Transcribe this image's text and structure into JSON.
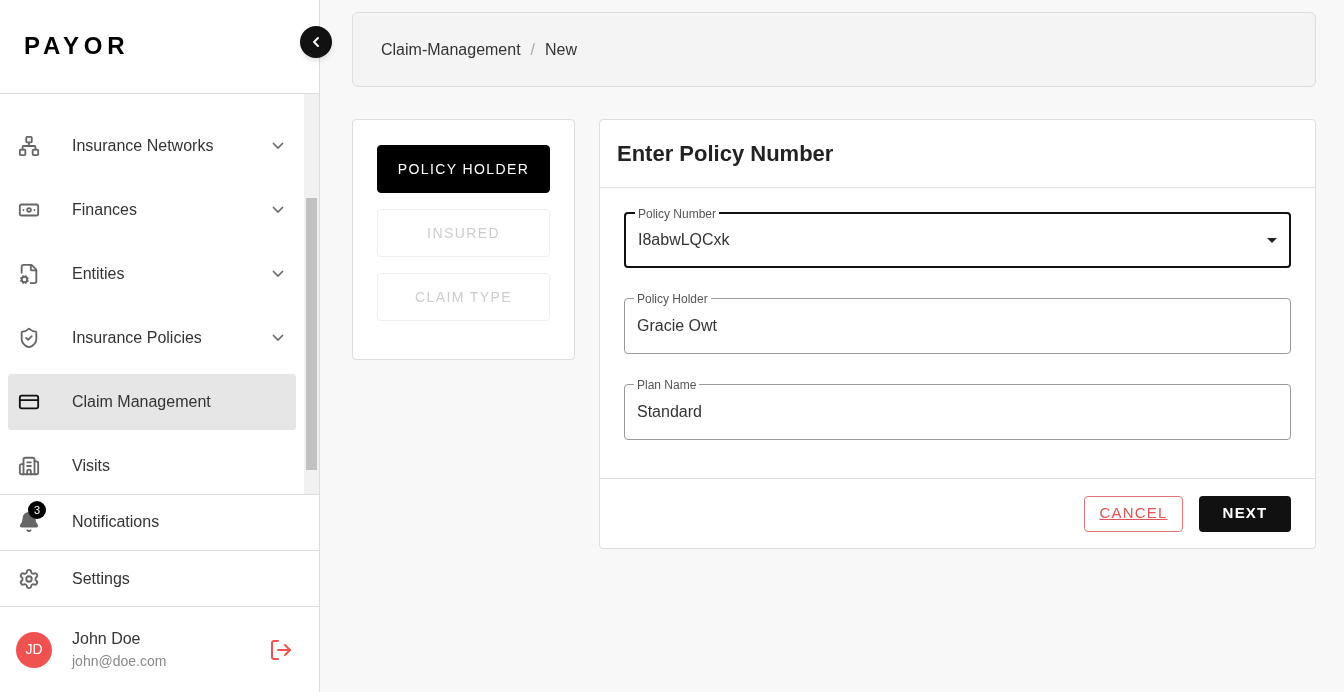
{
  "sidebar": {
    "logo": "PAYOR",
    "items": [
      {
        "label": "Insurance Networks",
        "expandable": true,
        "selected": false
      },
      {
        "label": "Finances",
        "expandable": true,
        "selected": false
      },
      {
        "label": "Entities",
        "expandable": true,
        "selected": false
      },
      {
        "label": "Insurance Policies",
        "expandable": true,
        "selected": false
      },
      {
        "label": "Claim Management",
        "expandable": false,
        "selected": true
      },
      {
        "label": "Visits",
        "expandable": false,
        "selected": false
      }
    ],
    "notifications": {
      "label": "Notifications",
      "badge": "3"
    },
    "settings": {
      "label": "Settings"
    },
    "user": {
      "initials": "JD",
      "name": "John Doe",
      "email": "john@doe.com"
    }
  },
  "breadcrumb": {
    "items": [
      "Claim-Management",
      "New"
    ],
    "separator": "/"
  },
  "steps": [
    {
      "label": "POLICY HOLDER",
      "selected": true,
      "disabled": false
    },
    {
      "label": "INSURED",
      "selected": false,
      "disabled": true
    },
    {
      "label": "CLAIM TYPE",
      "selected": false,
      "disabled": true
    }
  ],
  "form": {
    "title": "Enter Policy Number",
    "fields": [
      {
        "kind": "select",
        "label": "Policy Number",
        "value": "I8abwLQCxk",
        "focused": true
      },
      {
        "kind": "text",
        "label": "Policy Holder",
        "value": "Gracie Owt",
        "focused": false
      },
      {
        "kind": "text",
        "label": "Plan Name",
        "value": "Standard",
        "focused": false
      }
    ],
    "buttons": {
      "cancel": "CANCEL",
      "next": "NEXT"
    }
  }
}
